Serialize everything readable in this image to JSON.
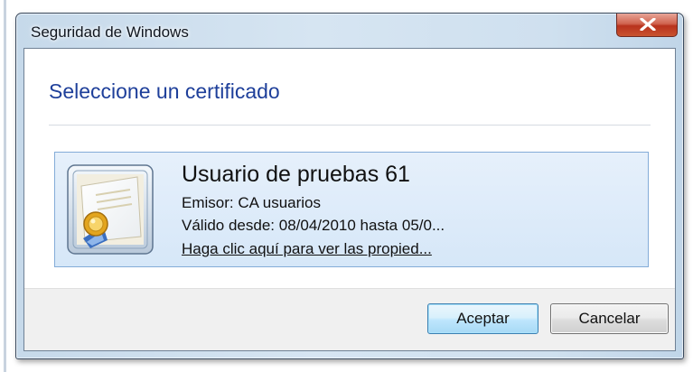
{
  "window": {
    "title": "Seguridad de Windows"
  },
  "dialog": {
    "heading": "Seleccione un certificado",
    "certificate": {
      "name": "Usuario de pruebas 61",
      "issuer": "Emisor: CA usuarios",
      "validity": "Válido desde: 08/04/2010 hasta 05/0...",
      "properties_link": "Haga clic aquí para ver las propied...",
      "icon": "certificate-icon"
    }
  },
  "footer": {
    "ok_label": "Aceptar",
    "cancel_label": "Cancelar"
  },
  "colors": {
    "heading": "#1e3f9a",
    "tile_border": "#84acd8",
    "tile_background": "#dbe9f9",
    "close_button": "#c9452c",
    "ok_button_border": "#3c7fb1"
  }
}
